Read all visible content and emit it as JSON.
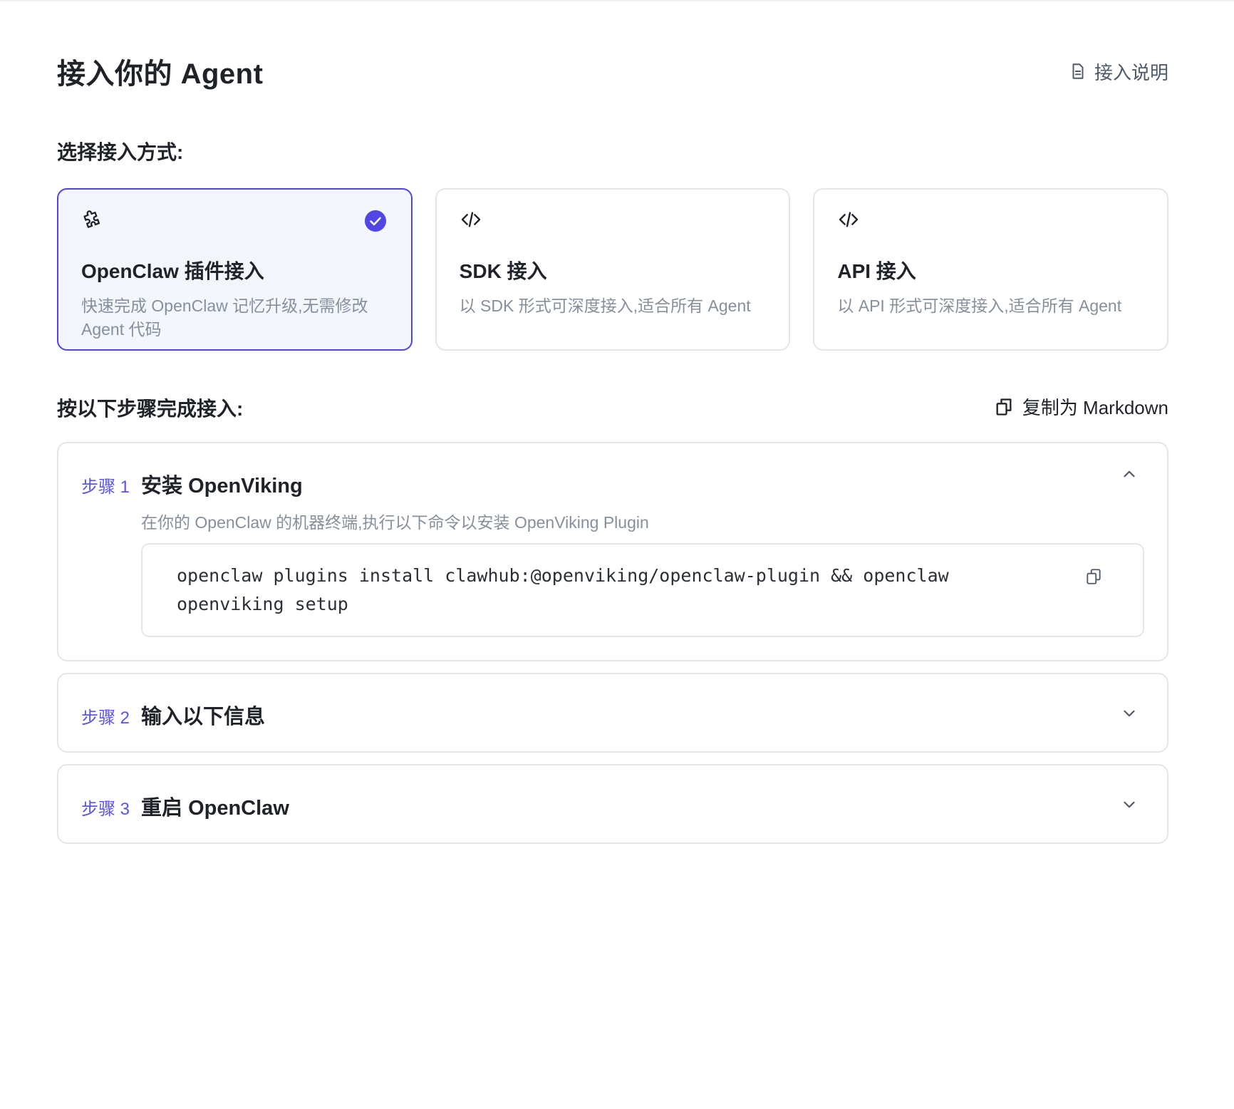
{
  "header": {
    "title": "接入你的 Agent",
    "guide_label": "接入说明",
    "guide_icon": "document-icon"
  },
  "mode_section": {
    "label": "选择接入方式:",
    "selected": "openclaw",
    "options": [
      {
        "id": "openclaw",
        "icon": "puzzle-icon",
        "title": "OpenClaw 插件接入",
        "description": "快速完成 OpenClaw 记忆升级,无需修改 Agent 代码",
        "selected": true
      },
      {
        "id": "sdk",
        "icon": "code-icon",
        "title": "SDK 接入",
        "description": "以 SDK 形式可深度接入,适合所有 Agent",
        "selected": false
      },
      {
        "id": "api",
        "icon": "code-icon",
        "title": "API 接入",
        "description": "以 API 形式可深度接入,适合所有 Agent",
        "selected": false
      }
    ]
  },
  "steps_section": {
    "label": "按以下步骤完成接入:",
    "copy_markdown_label": "复制为 Markdown",
    "steps": [
      {
        "number_label": "步骤 1",
        "title": "安装 OpenViking",
        "expanded": true,
        "description": "在你的 OpenClaw 的机器终端,执行以下命令以安装 OpenViking Plugin",
        "command": "openclaw plugins install clawhub:@openviking/openclaw-plugin && openclaw openviking setup"
      },
      {
        "number_label": "步骤 2",
        "title": "输入以下信息",
        "expanded": false
      },
      {
        "number_label": "步骤 3",
        "title": "重启 OpenClaw",
        "expanded": false
      }
    ]
  },
  "colors": {
    "accent": "#4f46e5",
    "selected_bg": "#f4f6fe",
    "border": "#e5e6eb",
    "muted_text": "#86909c"
  }
}
